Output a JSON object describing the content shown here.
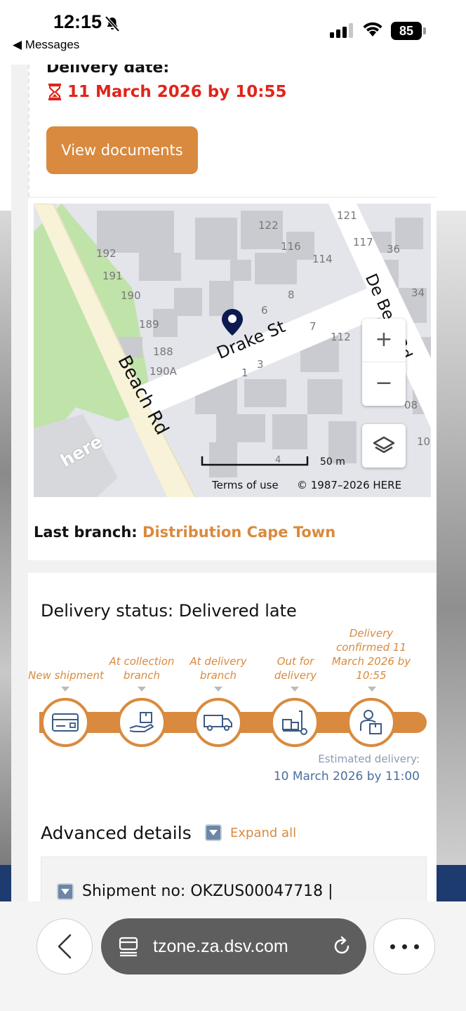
{
  "status_bar": {
    "time": "12:15",
    "back_app": "◀ Messages",
    "battery": "85"
  },
  "delivery": {
    "label": "Delivery date:",
    "date": "11 March 2026 by 10:55",
    "view_documents": "View documents",
    "date_color": "#e0251b"
  },
  "map": {
    "streets": [
      "Beach Rd",
      "Drake St",
      "De Beer Rd"
    ],
    "house_numbers": [
      "122",
      "121",
      "117",
      "36",
      "116",
      "114",
      "192",
      "191",
      "190",
      "6",
      "8",
      "34",
      "189",
      "7",
      "112",
      "188",
      "190A",
      "1",
      "3",
      "08",
      "10",
      "4"
    ],
    "scale": "50 m",
    "terms": "Terms of use",
    "copyright": "© 1987–2026 HERE",
    "logo": "here",
    "zoom_in": "+",
    "zoom_out": "−"
  },
  "last_branch": {
    "label": "Last branch:",
    "value": "Distribution Cape Town"
  },
  "status": {
    "title": "Delivery status: Delivered late",
    "steps": [
      {
        "label": "New shipment",
        "icon": "credit-card-icon"
      },
      {
        "label": "At collection branch",
        "icon": "hand-package-icon"
      },
      {
        "label": "At delivery branch",
        "icon": "truck-icon"
      },
      {
        "label": "Out for delivery",
        "icon": "hand-truck-icon"
      },
      {
        "label": "Delivery confirmed 11 March 2026 by 10:55",
        "icon": "person-package-icon"
      }
    ],
    "estimated_label": "Estimated delivery:",
    "estimated_date": "10 March 2026 by 11:00",
    "accent_color": "#d98a3e"
  },
  "advanced": {
    "title": "Advanced details",
    "expand_all": "Expand all",
    "shipment_no": "Shipment no: OKZUS00047718 |"
  },
  "browser": {
    "url": "tzone.za.dsv.com"
  }
}
